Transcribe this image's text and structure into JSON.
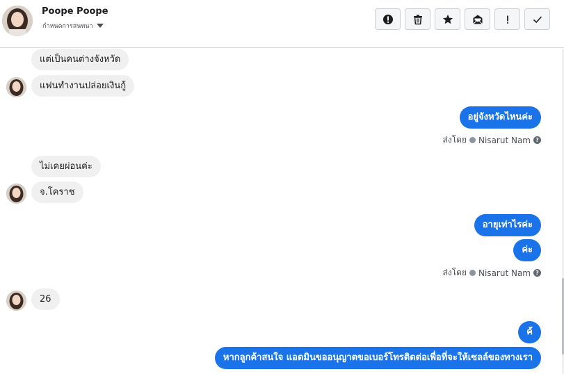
{
  "header": {
    "contact_name": "Poope Poope",
    "subtitle": "กำหนดการสนทนา",
    "toolbar": [
      {
        "id": "spam",
        "icon": "exclamation-circle-icon"
      },
      {
        "id": "delete",
        "icon": "trash-icon"
      },
      {
        "id": "star",
        "icon": "star-icon"
      },
      {
        "id": "mark-unread",
        "icon": "envelope-open-icon"
      },
      {
        "id": "important",
        "icon": "exclamation-icon"
      },
      {
        "id": "done",
        "icon": "checkmark-icon"
      }
    ]
  },
  "messages": {
    "m1": "แต่เป็นคนต่างจังหวัด",
    "m2": "แฟนทำงานปล่อยเงินกู้",
    "m3": "อยู่จังหวัดไหนค่ะ",
    "m4": "ไม่เคยผ่อนค่ะ",
    "m5": "จ.โคราช",
    "m6": "อายุเท่าไรค่ะ",
    "m7": "ค่ะ",
    "m8": "26",
    "m9": "ค้",
    "m10": "หากลูกค้าสนใจ แอดมินขออนุญาตขอเบอร์โทรติดต่อเพื่อที่จะให้เซลล์ของทางเรา"
  },
  "sent_by": {
    "label": "ส่งโดย",
    "agent": "Nisarut Nam"
  },
  "colors": {
    "outgoing_bubble": "#1a73e8",
    "incoming_bubble": "#f0f0f0"
  }
}
